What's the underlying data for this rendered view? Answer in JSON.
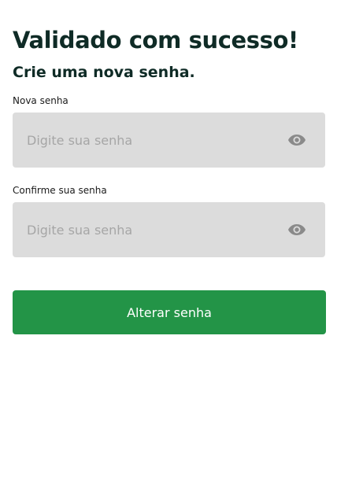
{
  "header": {
    "title": "Validado com sucesso!",
    "subtitle": "Crie uma nova senha."
  },
  "form": {
    "new_password": {
      "label": "Nova senha",
      "placeholder": "Digite sua senha",
      "value": "",
      "icon": "eye-icon"
    },
    "confirm_password": {
      "label": "Confirme sua senha",
      "placeholder": "Digite sua senha",
      "value": "",
      "icon": "eye-icon"
    },
    "submit_label": "Alterar senha"
  },
  "colors": {
    "primary": "#239447",
    "input_background": "#dcdcdc",
    "title_text": "#0f2b26",
    "placeholder_text": "#a6a6a6",
    "icon": "#8a8a8a"
  }
}
